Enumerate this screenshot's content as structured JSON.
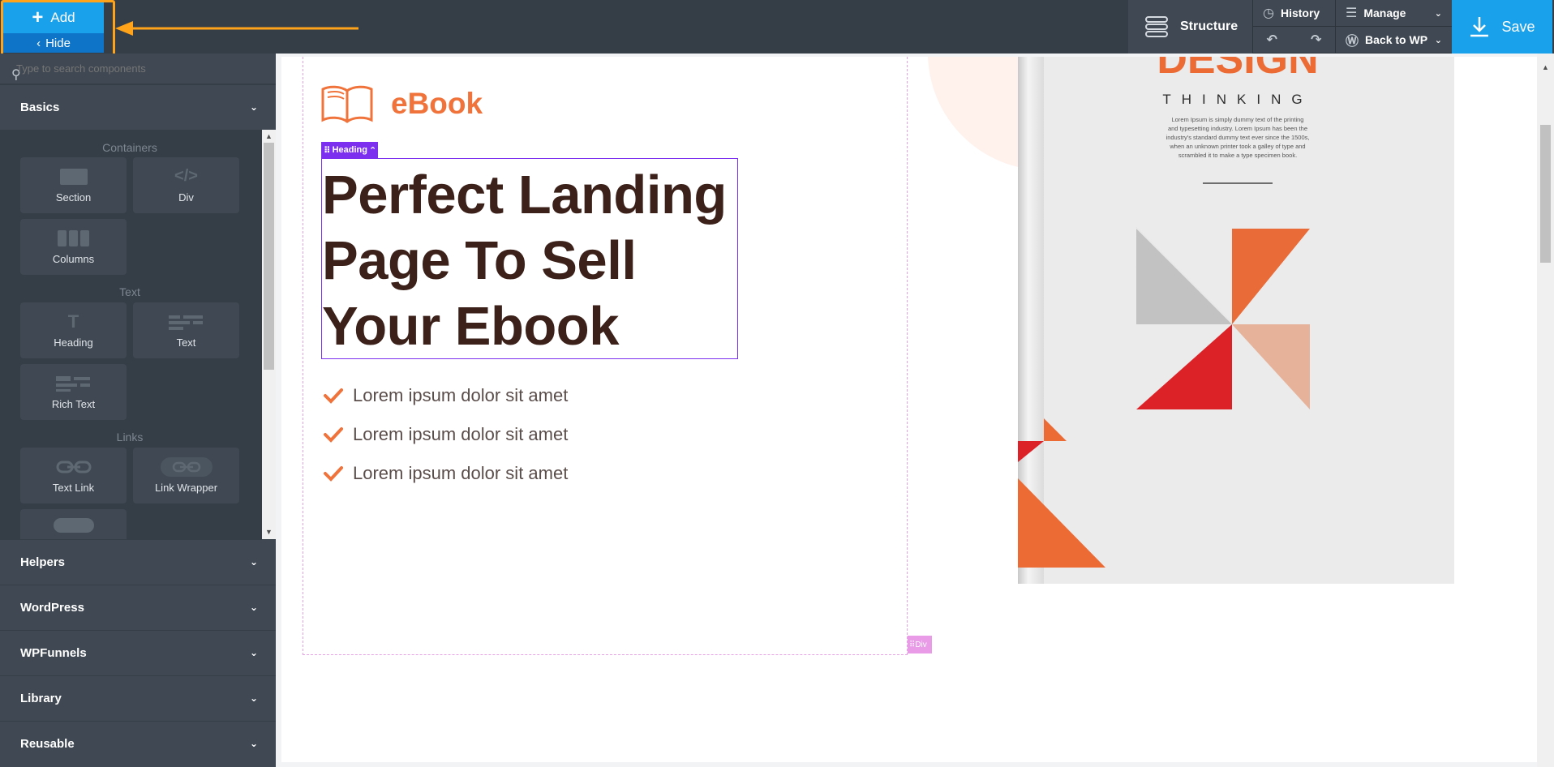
{
  "toolbar": {
    "add_label": "Add",
    "hide_label": "Hide",
    "structure_label": "Structure",
    "history_label": "History",
    "manage_label": "Manage",
    "back_label": "Back to WP",
    "save_label": "Save"
  },
  "sidebar": {
    "search_placeholder": "Type to search components",
    "basics_label": "Basics",
    "sections": {
      "containers": "Containers",
      "text": "Text",
      "links": "Links"
    },
    "tiles": {
      "section": "Section",
      "div": "Div",
      "columns": "Columns",
      "heading": "Heading",
      "text": "Text",
      "rich_text": "Rich Text",
      "text_link": "Text Link",
      "link_wrapper": "Link Wrapper"
    },
    "panels": [
      "Helpers",
      "WordPress",
      "WPFunnels",
      "Library",
      "Reusable"
    ]
  },
  "canvas": {
    "logo_text": "eBook",
    "heading_tag": "Heading",
    "heading_lines": [
      "Perfect Landing",
      "Page To Sell",
      "Your Ebook"
    ],
    "bullets": [
      "Lorem ipsum dolor sit amet",
      "Lorem ipsum dolor sit amet",
      "Lorem ipsum dolor sit amet"
    ],
    "div_tag": "Div",
    "book": {
      "title": "DESIGN",
      "subtitle": "THINKING",
      "blurb": [
        "Lorem Ipsum is simply dummy text of the printing",
        "and typesetting industry. Lorem Ipsum has been the",
        "industry's standard dummy text ever since the 1500s,",
        "when an unknown printer took a galley of type and",
        "scrambled it to make a type specimen book."
      ]
    }
  },
  "colors": {
    "accent": "#1aa1eb",
    "highlight": "#ffa41a",
    "brand_orange": "#f0733b",
    "heading": "#3b2119",
    "selection": "#7c2fef"
  }
}
